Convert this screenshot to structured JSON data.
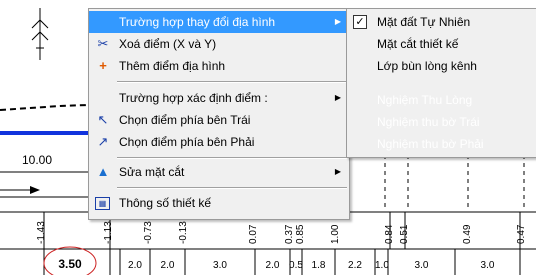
{
  "drawing": {
    "level_label": "10.00",
    "stations": [
      "-1.43",
      "-1.13",
      "-0.73",
      "-0.13",
      "0.07",
      "0.37",
      "0.85",
      "1.00",
      "0.84",
      "0.51",
      "0.49",
      "0.47"
    ],
    "distances": [
      "3.50",
      "2.0",
      "2.0",
      "3.0",
      "2.0",
      "0.5",
      "1.8",
      "2.2",
      "1.0",
      "3.0",
      "3.0"
    ]
  },
  "menu": {
    "items": [
      {
        "label": "Trường hợp thay đổi địa hình",
        "icon": "",
        "has_submenu": true,
        "highlighted": true
      },
      {
        "label": "Xoá điểm  (X và Y)",
        "icon": "delete-point-icon"
      },
      {
        "label": "Thêm điểm  địa hình",
        "icon": "add-point-icon"
      },
      {
        "label": "Trường hợp xác định điểm :",
        "icon": "",
        "has_submenu": true
      },
      {
        "label": "Chọn điểm phía  bên Trái",
        "icon": "select-left-icon"
      },
      {
        "label": "Chọn điểm phía bên Phải",
        "icon": "select-right-icon"
      },
      {
        "label": "Sửa mặt cắt",
        "icon": "edit-section-icon",
        "has_submenu": true
      },
      {
        "label": "Thông số thiết kế",
        "icon": "design-params-icon"
      }
    ]
  },
  "submenu": {
    "items": [
      {
        "label": "Mặt đất Tự Nhiên",
        "checked": true
      },
      {
        "label": "Mặt cắt thiết kế"
      },
      {
        "label": "Lớp bùn lòng kênh"
      },
      {
        "label": "Nghiệm Thu Lòng",
        "disabled": true
      },
      {
        "label": "Nghiệm thu bờ Trái",
        "disabled": true
      },
      {
        "label": "Nghiệm thu bờ Phải",
        "disabled": true
      }
    ]
  }
}
